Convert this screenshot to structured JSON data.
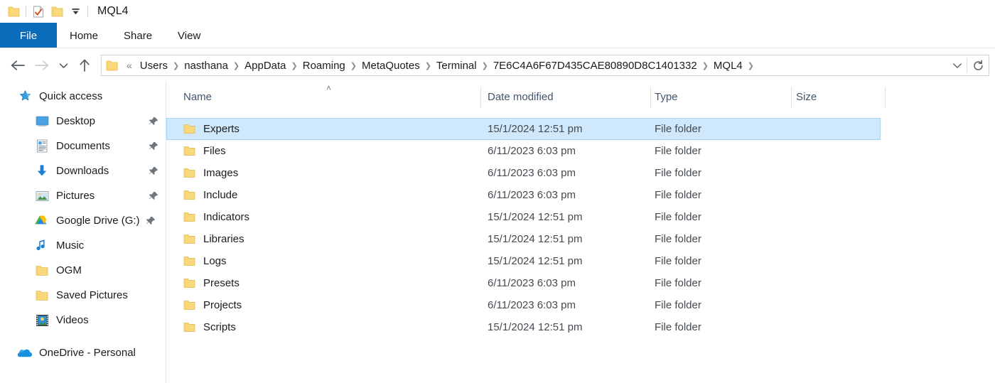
{
  "window": {
    "title": "MQL4",
    "quick_access_toolbar": [
      {
        "name": "folder-icon",
        "label": "Folder"
      },
      {
        "name": "properties-icon",
        "label": "Properties"
      },
      {
        "name": "new-folder-icon",
        "label": "New folder"
      },
      {
        "name": "chevron-down-icon",
        "label": "Customize Quick Access Toolbar"
      }
    ]
  },
  "ribbon": {
    "tabs": [
      {
        "label": "File",
        "active": true
      },
      {
        "label": "Home",
        "active": false
      },
      {
        "label": "Share",
        "active": false
      },
      {
        "label": "View",
        "active": false
      }
    ]
  },
  "navigation": {
    "back_label": "Back",
    "forward_label": "Forward",
    "recent_label": "Recent locations",
    "up_label": "Up one level",
    "refresh_label": "Refresh",
    "dropdown_label": "Previous locations",
    "overflow": "«",
    "breadcrumbs": [
      "Users",
      "nasthana",
      "AppData",
      "Roaming",
      "MetaQuotes",
      "Terminal",
      "7E6C4A6F67D435CAE80890D8C1401332",
      "MQL4"
    ]
  },
  "sidebar": {
    "items": [
      {
        "label": "Quick access",
        "icon": "star-icon",
        "level": 0,
        "pinned": false
      },
      {
        "label": "Desktop",
        "icon": "desktop-icon",
        "level": 1,
        "pinned": true
      },
      {
        "label": "Documents",
        "icon": "documents-icon",
        "level": 1,
        "pinned": true
      },
      {
        "label": "Downloads",
        "icon": "downloads-icon",
        "level": 1,
        "pinned": true
      },
      {
        "label": "Pictures",
        "icon": "pictures-icon",
        "level": 1,
        "pinned": true
      },
      {
        "label": "Google Drive (G:)",
        "icon": "google-drive-icon",
        "level": 1,
        "pinned": true
      },
      {
        "label": "Music",
        "icon": "music-icon",
        "level": 1,
        "pinned": false
      },
      {
        "label": "OGM",
        "icon": "folder-icon",
        "level": 1,
        "pinned": false
      },
      {
        "label": "Saved Pictures",
        "icon": "folder-icon",
        "level": 1,
        "pinned": false
      },
      {
        "label": "Videos",
        "icon": "videos-icon",
        "level": 1,
        "pinned": false
      },
      {
        "label": "OneDrive - Personal",
        "icon": "onedrive-icon",
        "level": 0,
        "pinned": false
      }
    ]
  },
  "file_list": {
    "columns": [
      {
        "label": "Name",
        "sorted": "asc"
      },
      {
        "label": "Date modified",
        "sorted": null
      },
      {
        "label": "Type",
        "sorted": null
      },
      {
        "label": "Size",
        "sorted": null
      }
    ],
    "sort_indicator": "˄",
    "rows": [
      {
        "name": "Experts",
        "date": "15/1/2024 12:51 pm",
        "type": "File folder",
        "size": "",
        "selected": true
      },
      {
        "name": "Files",
        "date": "6/11/2023 6:03 pm",
        "type": "File folder",
        "size": "",
        "selected": false
      },
      {
        "name": "Images",
        "date": "6/11/2023 6:03 pm",
        "type": "File folder",
        "size": "",
        "selected": false
      },
      {
        "name": "Include",
        "date": "6/11/2023 6:03 pm",
        "type": "File folder",
        "size": "",
        "selected": false
      },
      {
        "name": "Indicators",
        "date": "15/1/2024 12:51 pm",
        "type": "File folder",
        "size": "",
        "selected": false
      },
      {
        "name": "Libraries",
        "date": "15/1/2024 12:51 pm",
        "type": "File folder",
        "size": "",
        "selected": false
      },
      {
        "name": "Logs",
        "date": "15/1/2024 12:51 pm",
        "type": "File folder",
        "size": "",
        "selected": false
      },
      {
        "name": "Presets",
        "date": "6/11/2023 6:03 pm",
        "type": "File folder",
        "size": "",
        "selected": false
      },
      {
        "name": "Projects",
        "date": "6/11/2023 6:03 pm",
        "type": "File folder",
        "size": "",
        "selected": false
      },
      {
        "name": "Scripts",
        "date": "15/1/2024 12:51 pm",
        "type": "File folder",
        "size": "",
        "selected": false
      }
    ]
  },
  "colors": {
    "accent": "#0b6cbb",
    "selection_fill": "#cfe8fc",
    "selection_border": "#a6d4f5",
    "folder_yellow": "#fbd97a",
    "header_text": "#44546a"
  }
}
